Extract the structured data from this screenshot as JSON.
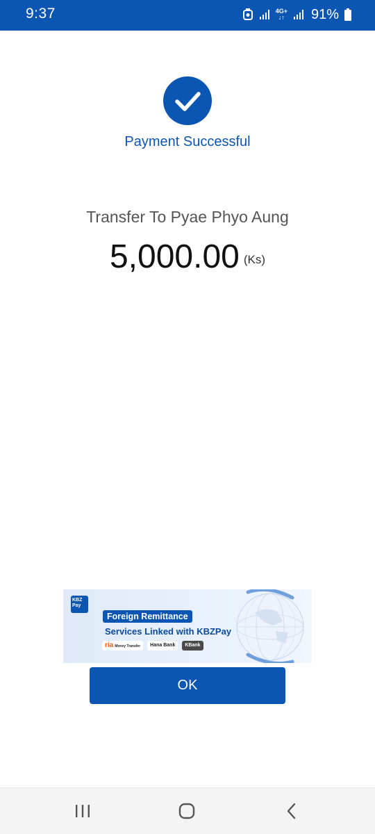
{
  "status_bar": {
    "time": "9:37",
    "network": "4G+",
    "battery": "91%"
  },
  "result": {
    "title": "Payment Successful",
    "transfer_text": "Transfer To Pyae Phyo Aung",
    "amount": "5,000.00",
    "currency": "(Ks)"
  },
  "banner": {
    "logo_top": "KBZ",
    "logo_bottom": "Pay",
    "headline": "Foreign Remittance",
    "subline": "Services Linked with KBZPay",
    "partners": [
      "ria",
      "Money Transfer",
      "Hana Bank",
      "KBank"
    ]
  },
  "actions": {
    "ok_label": "OK"
  },
  "colors": {
    "primary": "#0b55b3",
    "background": "#ffffff"
  }
}
